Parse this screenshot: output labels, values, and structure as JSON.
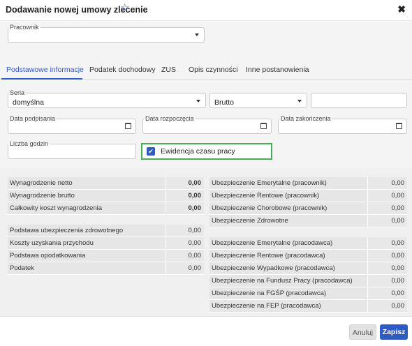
{
  "dialog": {
    "title": "Dodawanie nowej umowy zlecenie",
    "star_icon": "☆",
    "close_icon": "✖"
  },
  "form": {
    "pracownik": {
      "label": "Pracownik",
      "value": ""
    },
    "seria": {
      "label": "Seria",
      "value": "domyślna"
    },
    "brutto": {
      "value": "Brutto"
    },
    "amount": {
      "value": ""
    },
    "data_podpisania": {
      "label": "Data podpisania",
      "value": ""
    },
    "data_rozpoczecia": {
      "label": "Data rozpoczęcia",
      "value": ""
    },
    "data_zakonczenia": {
      "label": "Data zakończenia",
      "value": ""
    },
    "liczba_godzin": {
      "label": "Liczba godzin",
      "value": ""
    },
    "ewidencja": {
      "label": "Ewidencja czasu pracy",
      "checked": true
    }
  },
  "tabs": [
    {
      "label": "Podstawowe informacje",
      "active": true
    },
    {
      "label": "Podatek dochodowy",
      "active": false
    },
    {
      "label": "ZUS",
      "active": false
    },
    {
      "label": "Opis czynności",
      "active": false
    },
    {
      "label": "Inne postanowienia",
      "active": false
    }
  ],
  "summary_left_top": [
    {
      "label": "Wynagrodzenie netto",
      "value": "0,00"
    },
    {
      "label": "Wynagrodzenie brutto",
      "value": "0,00"
    },
    {
      "label": "Całkowity koszt wynagrodzenia",
      "value": "0,00"
    }
  ],
  "summary_left_bottom": [
    {
      "label": "Podstawa ubezpieczenia zdrowotnego",
      "value": "0,00"
    },
    {
      "label": "Koszty uzyskania przychodu",
      "value": "0,00"
    },
    {
      "label": "Podstawa opodatkowania",
      "value": "0,00"
    },
    {
      "label": "Podatek",
      "value": "0,00"
    }
  ],
  "summary_right_top": [
    {
      "label": "Ubezpieczenie Emerytalne (pracownik)",
      "value": "0,00"
    },
    {
      "label": "Ubezpieczenie Rentowe (pracownik)",
      "value": "0,00"
    },
    {
      "label": "Ubezpieczenie Chorobowe (pracownik)",
      "value": "0,00"
    },
    {
      "label": "Ubezpieczenie Zdrowotne",
      "value": "0,00"
    }
  ],
  "summary_right_bottom": [
    {
      "label": "Ubezpieczenie Emerytalne (pracodawca)",
      "value": "0,00"
    },
    {
      "label": "Ubezpieczenie Rentowe (pracodawca)",
      "value": "0,00"
    },
    {
      "label": "Ubezpieczenie Wypadkowe (pracodawca)",
      "value": "0,00"
    },
    {
      "label": "Ubezpieczenie na Fundusz Pracy (pracodawca)",
      "value": "0,00"
    },
    {
      "label": "Ubezpieczenie na FGŚP (pracodawca)",
      "value": "0,00"
    },
    {
      "label": "Ubezpieczenie na FEP (pracodawca)",
      "value": "0,00"
    }
  ],
  "footer": {
    "cancel_label": "Anuluj",
    "save_label": "Zapisz"
  },
  "colors": {
    "accent": "#2f5bc4",
    "highlight_border": "#44b254"
  }
}
